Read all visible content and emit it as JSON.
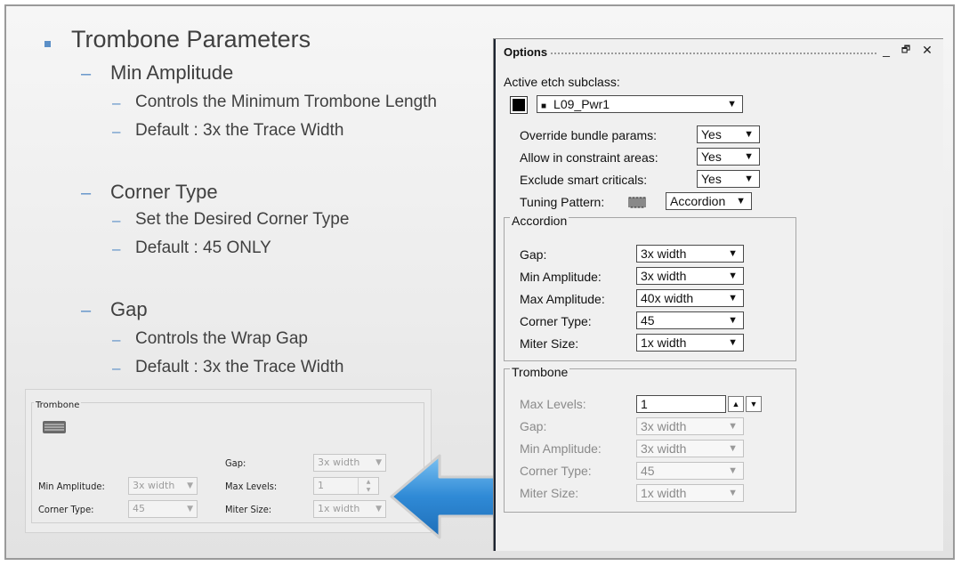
{
  "slide": {
    "title": "Trombone Parameters",
    "sections": [
      {
        "heading": "Min Amplitude",
        "items": [
          "Controls the Minimum Trombone Length",
          "Default : 3x the Trace Width"
        ]
      },
      {
        "heading": "Corner Type",
        "items": [
          "Set the Desired Corner Type",
          "Default : 45 ONLY"
        ]
      },
      {
        "heading": "Gap",
        "items": [
          "Controls the Wrap Gap",
          "Default : 3x the Trace Width"
        ]
      }
    ],
    "dash_glyph": "–",
    "accent_color": "#5b8fc7"
  },
  "legacy_panel": {
    "caption": "Trombone",
    "icon": "trombone-pattern-icon",
    "gap_label": "Gap:",
    "gap_value": "3x width",
    "min_amplitude_label": "Min Amplitude:",
    "min_amplitude_value": "3x width",
    "max_levels_label": "Max Levels:",
    "max_levels_value": "1",
    "corner_type_label": "Corner Type:",
    "corner_type_value": "45",
    "miter_size_label": "Miter Size:",
    "miter_size_value": "1x width"
  },
  "arrow": {
    "icon": "arrow-left-icon",
    "color": "#3a8fd8"
  },
  "options": {
    "title": "Options",
    "controls": {
      "minimize": "_",
      "restore": "🗗",
      "close": "✕"
    },
    "active_etch_label": "Active etch subclass:",
    "active_etch_value": "L09_Pwr1",
    "active_etch_color": "#000000",
    "override_label": "Override bundle params:",
    "override_value": "Yes",
    "allow_label": "Allow in constraint areas:",
    "allow_value": "Yes",
    "exclude_label": "Exclude smart criticals:",
    "exclude_value": "Yes",
    "tuning_label": "Tuning Pattern:",
    "tuning_icon": "accordion-pattern-icon",
    "tuning_value": "Accordion",
    "accordion": {
      "caption": "Accordion",
      "rows": [
        {
          "label": "Gap:",
          "value": "3x width"
        },
        {
          "label": "Min Amplitude:",
          "value": "3x width"
        },
        {
          "label": "Max Amplitude:",
          "value": "40x width"
        },
        {
          "label": "Corner Type:",
          "value": "45"
        },
        {
          "label": "Miter Size:",
          "value": "1x width"
        }
      ]
    },
    "trombone": {
      "caption": "Trombone",
      "max_levels_label": "Max Levels:",
      "max_levels_value": "1",
      "rows": [
        {
          "label": "Gap:",
          "value": "3x width"
        },
        {
          "label": "Min Amplitude:",
          "value": "3x width"
        },
        {
          "label": "Corner Type:",
          "value": "45"
        },
        {
          "label": "Miter Size:",
          "value": "1x width"
        }
      ]
    },
    "dropdown_arrow": "▼",
    "spin_up": "▲",
    "spin_down": "▼"
  }
}
